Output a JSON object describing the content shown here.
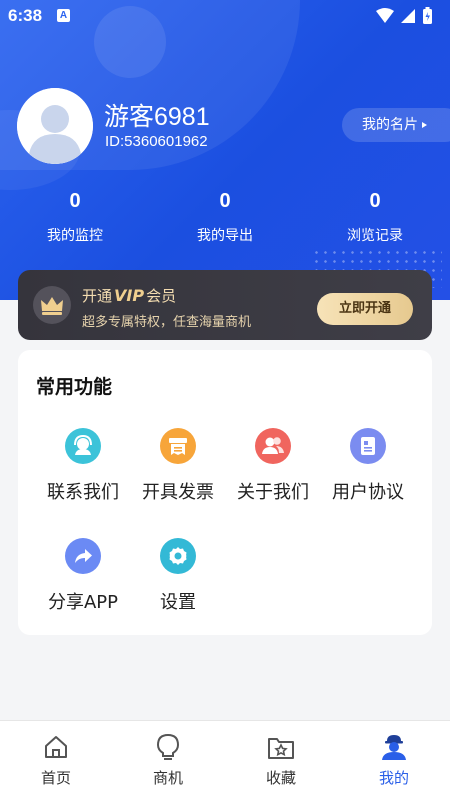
{
  "status_bar": {
    "time": "6:38",
    "notification_icon": "A"
  },
  "profile": {
    "username": "游客6981",
    "user_id": "ID:5360601962",
    "card_button": "我的名片"
  },
  "stats": [
    {
      "value": "0",
      "label": "我的监控"
    },
    {
      "value": "0",
      "label": "我的导出"
    },
    {
      "value": "0",
      "label": "浏览记录"
    }
  ],
  "vip": {
    "title_prefix": "开通",
    "title_vip": "VIP",
    "title_suffix": "会员",
    "subtitle": "超多专属特权，任查海量商机",
    "button": "立即开通"
  },
  "functions": {
    "title": "常用功能",
    "items": [
      {
        "label": "联系我们",
        "icon": "customer-service-icon",
        "color": "#3cc3d9"
      },
      {
        "label": "开具发票",
        "icon": "invoice-icon",
        "color": "#f7a53a"
      },
      {
        "label": "关于我们",
        "icon": "users-icon",
        "color": "#f0655e"
      },
      {
        "label": "用户协议",
        "icon": "agreement-icon",
        "color": "#7b8cf0"
      },
      {
        "label": "分享APP",
        "icon": "share-icon",
        "color": "#6b8af4"
      },
      {
        "label": "设置",
        "icon": "settings-icon",
        "color": "#33b9d6"
      }
    ]
  },
  "nav": [
    {
      "label": "首页",
      "icon": "home-icon"
    },
    {
      "label": "商机",
      "icon": "lightbulb-icon"
    },
    {
      "label": "收藏",
      "icon": "folder-star-icon"
    },
    {
      "label": "我的",
      "icon": "profile-icon"
    }
  ],
  "colors": {
    "primary": "#2456ea",
    "accent": "#2a5fe8",
    "vip_gold": "#f0cf8f"
  }
}
